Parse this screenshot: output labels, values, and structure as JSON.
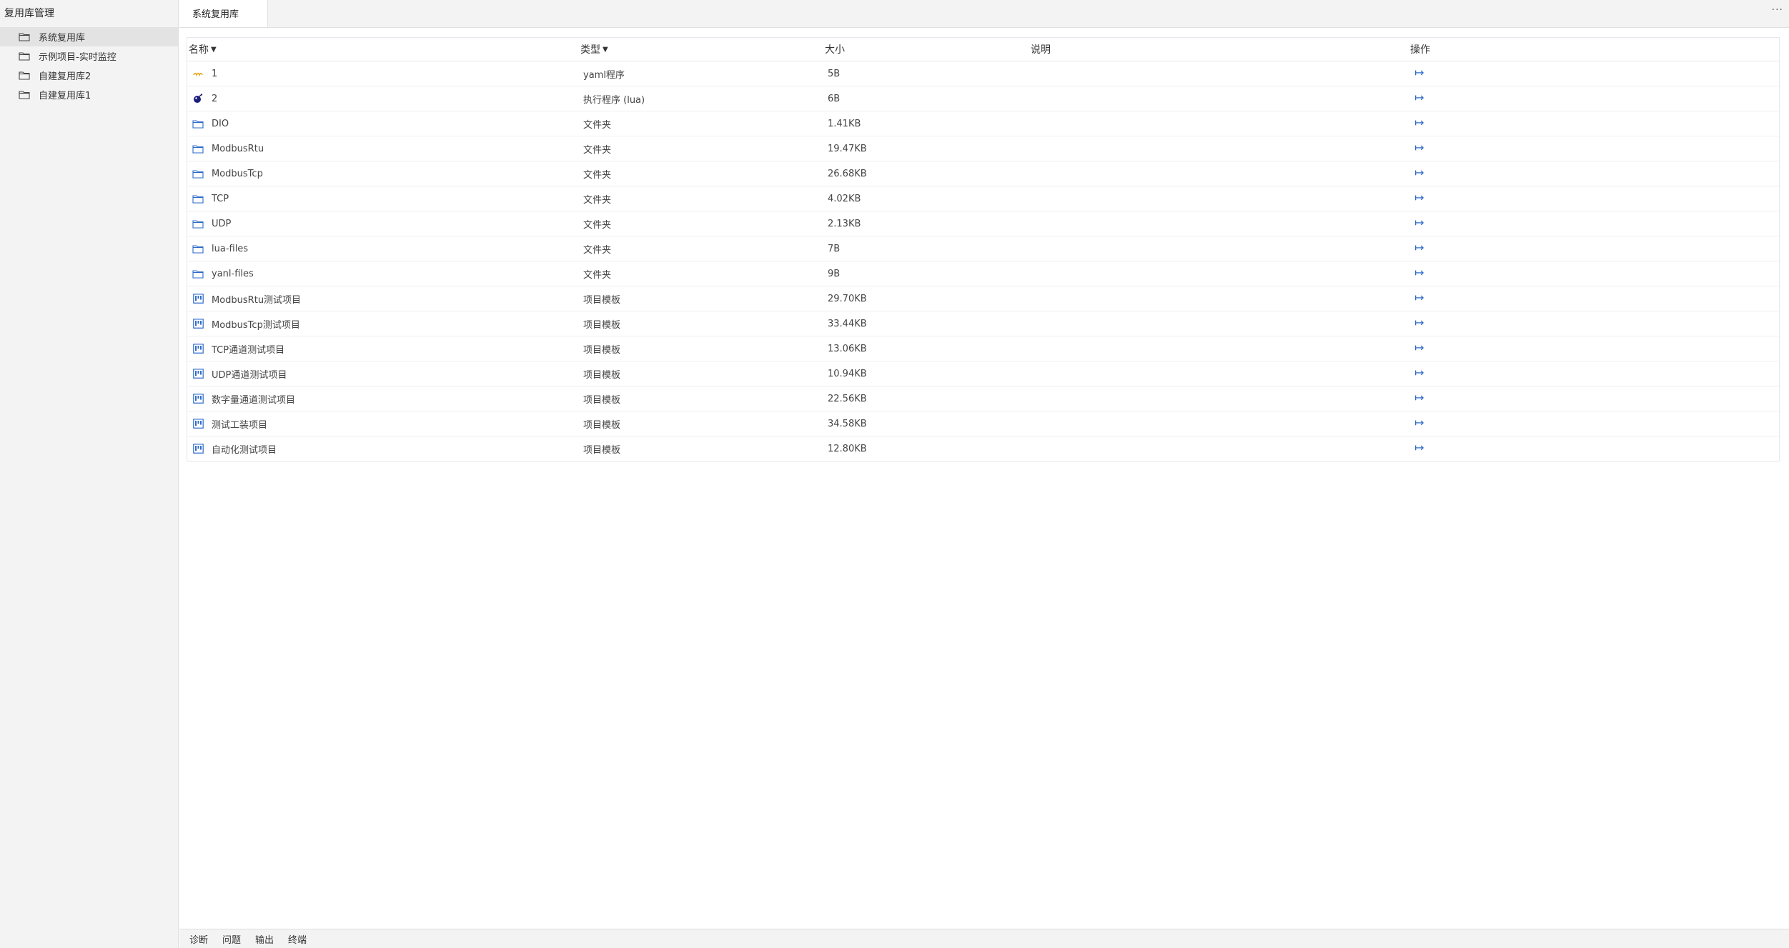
{
  "sidebar": {
    "title": "复用库管理",
    "items": [
      {
        "label": "系统复用库",
        "selected": true
      },
      {
        "label": "示例项目-实时监控",
        "selected": false
      },
      {
        "label": "自建复用库2",
        "selected": false
      },
      {
        "label": "自建复用库1",
        "selected": false
      }
    ]
  },
  "tabs": [
    {
      "label": "系统复用库"
    }
  ],
  "more_label": "···",
  "table": {
    "headers": {
      "name": "名称",
      "type": "类型",
      "size": "大小",
      "desc": "说明",
      "op": "操作"
    },
    "rows": [
      {
        "icon": "yaml-icon",
        "name": "1",
        "type": "yaml程序",
        "size": "5B",
        "desc": ""
      },
      {
        "icon": "lua-bomb-icon",
        "name": "2",
        "type": "执行程序 (lua)",
        "size": "6B",
        "desc": ""
      },
      {
        "icon": "folder-icon",
        "name": "DIO",
        "type": "文件夹",
        "size": "1.41KB",
        "desc": ""
      },
      {
        "icon": "folder-icon",
        "name": "ModbusRtu",
        "type": "文件夹",
        "size": "19.47KB",
        "desc": ""
      },
      {
        "icon": "folder-icon",
        "name": "ModbusTcp",
        "type": "文件夹",
        "size": "26.68KB",
        "desc": ""
      },
      {
        "icon": "folder-icon",
        "name": "TCP",
        "type": "文件夹",
        "size": "4.02KB",
        "desc": ""
      },
      {
        "icon": "folder-icon",
        "name": "UDP",
        "type": "文件夹",
        "size": "2.13KB",
        "desc": ""
      },
      {
        "icon": "folder-icon",
        "name": "lua-files",
        "type": "文件夹",
        "size": "7B",
        "desc": ""
      },
      {
        "icon": "folder-icon",
        "name": "yanl-files",
        "type": "文件夹",
        "size": "9B",
        "desc": ""
      },
      {
        "icon": "template-icon",
        "name": "ModbusRtu测试项目",
        "type": "项目模板",
        "size": "29.70KB",
        "desc": ""
      },
      {
        "icon": "template-icon",
        "name": "ModbusTcp测试项目",
        "type": "项目模板",
        "size": "33.44KB",
        "desc": ""
      },
      {
        "icon": "template-icon",
        "name": "TCP通道测试项目",
        "type": "项目模板",
        "size": "13.06KB",
        "desc": ""
      },
      {
        "icon": "template-icon",
        "name": "UDP通道测试项目",
        "type": "项目模板",
        "size": "10.94KB",
        "desc": ""
      },
      {
        "icon": "template-icon",
        "name": "数字量通道测试项目",
        "type": "项目模板",
        "size": "22.56KB",
        "desc": ""
      },
      {
        "icon": "template-icon",
        "name": "测试工装项目",
        "type": "项目模板",
        "size": "34.58KB",
        "desc": ""
      },
      {
        "icon": "template-icon",
        "name": "自动化测试项目",
        "type": "项目模板",
        "size": "12.80KB",
        "desc": ""
      }
    ]
  },
  "bottom_tabs": [
    {
      "label": "诊断"
    },
    {
      "label": "问题"
    },
    {
      "label": "输出"
    },
    {
      "label": "终端"
    }
  ],
  "colors": {
    "accent": "#2e6bc9",
    "yaml": "#e8a317",
    "lua": "#1b1f7a"
  }
}
